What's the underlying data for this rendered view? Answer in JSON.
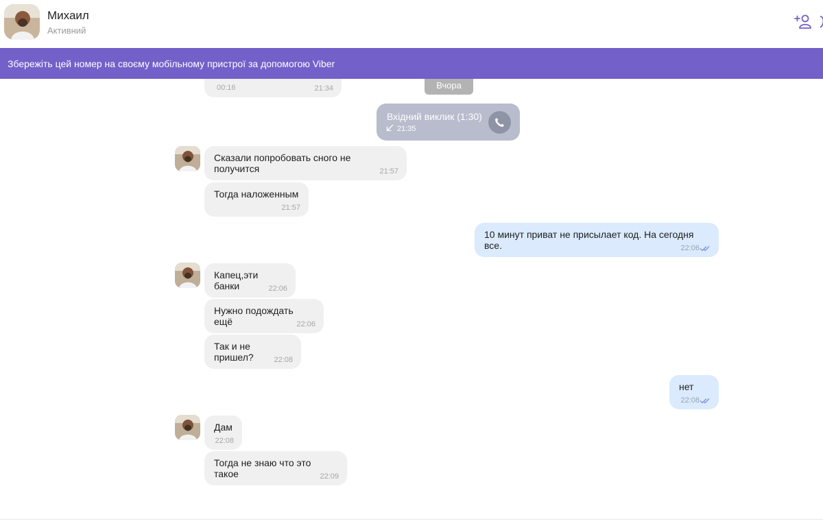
{
  "header": {
    "contact_name": "Михаил",
    "status": "Активний",
    "add_user_icon": "add-user-icon",
    "more_icon": "more-icon"
  },
  "banner": {
    "text": "Збережіть цей номер на своєму мобільному пристрої за допомогою Viber"
  },
  "colors": {
    "banner_bg": "#7360c9",
    "incoming_bubble": "#f0f0f0",
    "outgoing_bubble": "#dbeafc",
    "call_bubble": "#b8bccd",
    "ticks": "#7c8fd6"
  },
  "chat": {
    "partial_top": {
      "left_time": "00:16",
      "right_time": "21:34"
    },
    "date_separator": "Вчора",
    "call": {
      "title": "Вхідний виклик (1:30)",
      "time": "21:35"
    },
    "messages": [
      {
        "dir": "in",
        "text": "Сказали попробовать сного не получится",
        "time": "21:57"
      },
      {
        "dir": "in",
        "text": "Тогда наложенным",
        "time": "21:57"
      },
      {
        "dir": "out",
        "text": "10 минут приват не присылает код. На сегодня все.",
        "time": "22:06"
      },
      {
        "dir": "in",
        "text": "Капец,эти банки",
        "time": "22:06"
      },
      {
        "dir": "in",
        "text": "Нужно подождать ещё",
        "time": "22:06"
      },
      {
        "dir": "in",
        "text": "Так и не пришел?",
        "time": "22:08"
      },
      {
        "dir": "out",
        "text": "нет",
        "time": "22:08"
      },
      {
        "dir": "in",
        "text": "Дам",
        "time": "22:08"
      },
      {
        "dir": "in",
        "text": "Тогда не знаю что это такое",
        "time": "22:09"
      }
    ]
  }
}
